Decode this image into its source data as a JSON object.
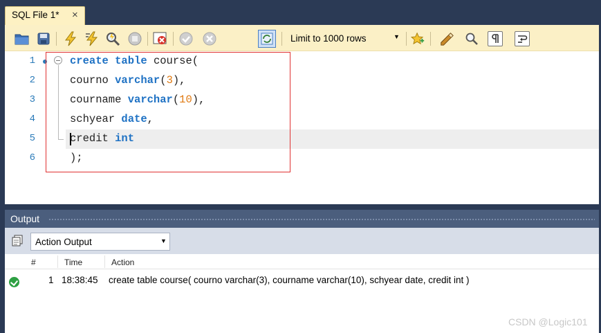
{
  "tab": {
    "title": "SQL File 1*",
    "close": "×"
  },
  "toolbar": {
    "icons": [
      "open-folder-icon",
      "save-icon",
      "execute-icon",
      "execute-current-icon",
      "explain-icon",
      "stop-icon",
      "toggle-error-icon",
      "commit-icon",
      "rollback-icon",
      "autocommit-icon",
      "bookmark-icon",
      "beautify-icon",
      "find-icon",
      "invisible-chars-icon",
      "wrap-icon"
    ],
    "limit": {
      "selected": "Limit to 1000 rows",
      "arrow": "▼"
    }
  },
  "editor": {
    "line_numbers": [
      "1",
      "2",
      "3",
      "4",
      "5",
      "6"
    ],
    "lines": [
      [
        {
          "t": "create",
          "c": "kw"
        },
        {
          "t": " "
        },
        {
          "t": "table",
          "c": "kw"
        },
        {
          "t": " course("
        }
      ],
      [
        {
          "t": "courno "
        },
        {
          "t": "varchar",
          "c": "kw"
        },
        {
          "t": "("
        },
        {
          "t": "3",
          "c": "num"
        },
        {
          "t": "),"
        }
      ],
      [
        {
          "t": "courname "
        },
        {
          "t": "varchar",
          "c": "kw"
        },
        {
          "t": "("
        },
        {
          "t": "10",
          "c": "num"
        },
        {
          "t": "),"
        }
      ],
      [
        {
          "t": "schyear "
        },
        {
          "t": "date",
          "c": "kw"
        },
        {
          "t": ","
        }
      ],
      [
        {
          "t": "credit "
        },
        {
          "t": "int",
          "c": "kw"
        }
      ],
      [
        {
          "t": ");"
        }
      ]
    ],
    "current_line": 5
  },
  "output": {
    "title": "Output",
    "mode": "Action Output",
    "arrow": "▼",
    "columns": [
      "#",
      "Time",
      "Action"
    ],
    "rows": [
      {
        "status": "ok",
        "num": "1",
        "time": "18:38:45",
        "action": "create table course( courno varchar(3), courname varchar(10), schyear date, credit int )"
      }
    ]
  },
  "watermark": "CSDN @Logic101",
  "colors": {
    "tab_active": "#fdf1c3",
    "toolbar": "#fbf0c6",
    "keyword": "#1f72c4",
    "number": "#e07a12",
    "line_number": "#2b7bb9",
    "highlight_box": "#e03030",
    "frame": "#2b3a55",
    "output_header": "#4b5e7d",
    "ok": "#2ea043"
  }
}
